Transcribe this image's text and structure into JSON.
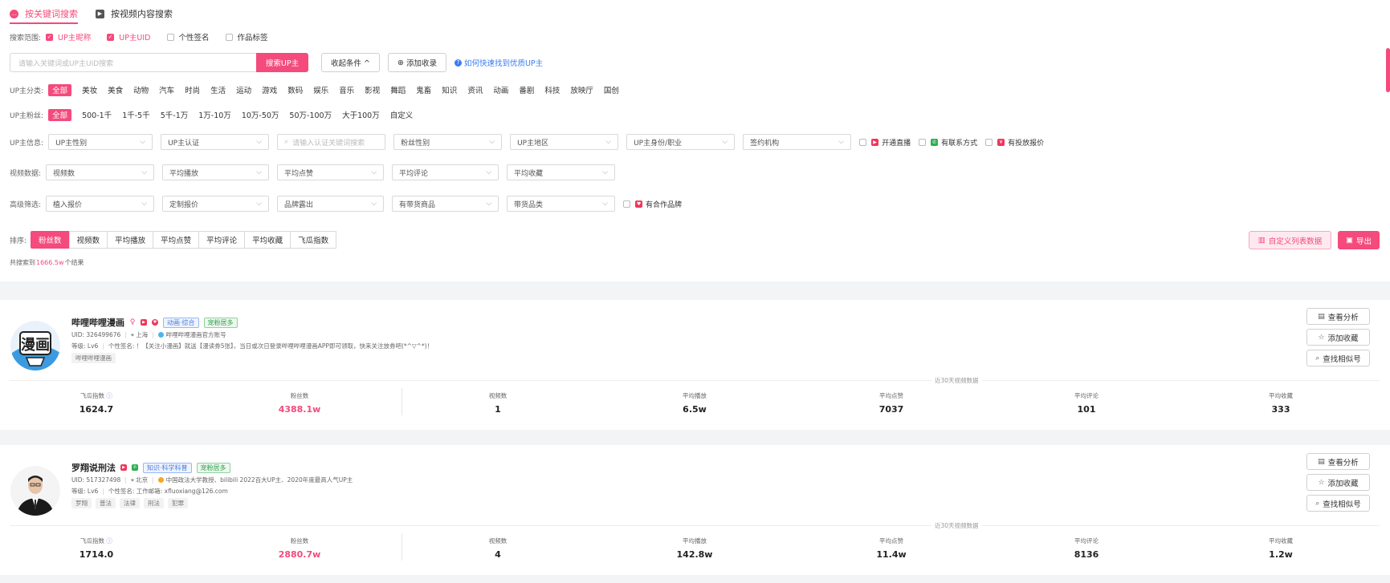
{
  "tabs": [
    {
      "label": "按关键词搜索"
    },
    {
      "label": "按视频内容搜索"
    }
  ],
  "scope": {
    "label": "搜索范围:",
    "options": [
      {
        "label": "UP主昵称",
        "checked": true
      },
      {
        "label": "UP主UID",
        "checked": true
      },
      {
        "label": "个性签名",
        "checked": false
      },
      {
        "label": "作品标签",
        "checked": false
      }
    ]
  },
  "search": {
    "placeholder": "请输入关键词或UP主UID搜索",
    "button": "搜索UP主",
    "collapse": "收起条件 ^",
    "add_fav": "添加收录",
    "help_link": "如何快速找到优质UP主"
  },
  "category": {
    "label": "UP主分类:",
    "items": [
      "全部",
      "美妆",
      "美食",
      "动物",
      "汽车",
      "时尚",
      "生活",
      "运动",
      "游戏",
      "数码",
      "娱乐",
      "音乐",
      "影视",
      "舞蹈",
      "鬼畜",
      "知识",
      "资讯",
      "动画",
      "番剧",
      "科技",
      "放映厅",
      "国创"
    ]
  },
  "fans": {
    "label": "UP主粉丝:",
    "items": [
      "全部",
      "500-1千",
      "1千-5千",
      "5千-1万",
      "1万-10万",
      "10万-50万",
      "50万-100万",
      "大于100万",
      "自定义"
    ]
  },
  "info": {
    "label": "UP主信息:",
    "selects": [
      "UP主性别",
      "UP主认证",
      "请输入认证关键词搜索",
      "粉丝性别",
      "UP主地区",
      "UP主身份/职业",
      "签约机构"
    ],
    "checks": [
      "开通直播",
      "有联系方式",
      "有投放报价"
    ]
  },
  "video": {
    "label": "视频数据:",
    "selects": [
      "视频数",
      "平均播放",
      "平均点赞",
      "平均评论",
      "平均收藏"
    ]
  },
  "advanced": {
    "label": "高级筛选:",
    "selects": [
      "植入报价",
      "定制报价",
      "品牌露出",
      "有带货商品",
      "带货品类"
    ],
    "check": "有合作品牌"
  },
  "sort": {
    "label": "排序:",
    "items": [
      "粉丝数",
      "视频数",
      "平均播放",
      "平均点赞",
      "平均评论",
      "平均收藏",
      "飞瓜指数"
    ],
    "custom_cols": "自定义列表数据",
    "export": "导出"
  },
  "result": {
    "prefix": "共搜索到 ",
    "count": "1666.5w",
    "suffix": "个结果"
  },
  "colors": {
    "accent": "#f44a7c",
    "blue": "#3a7cf2"
  },
  "cards": [
    {
      "name": "哔哩哔哩漫画",
      "tags": [
        "动画·综合",
        "宠粉居多"
      ],
      "uid": "UID: 326499676",
      "location": "上海",
      "verify": "哔哩哔哩漫画官方账号",
      "level": "等级: Lv6",
      "signature": "个性签名: ！【关注小漫画】就送【漫读券5张】，当日或次日登录哔哩哔哩漫画APP即可领取，快来关注放券吧(*^▽^*)！",
      "keywords": [
        "哔哩哔哩漫画"
      ],
      "actions": [
        "查看分析",
        "添加收藏",
        "查找相似号"
      ],
      "recent_label": "近30天视频数据",
      "stats": [
        {
          "label": "飞瓜指数",
          "value": "1624.7"
        },
        {
          "label": "粉丝数",
          "value": "4388.1w"
        },
        {
          "label": "视频数",
          "value": "1"
        },
        {
          "label": "平均播放",
          "value": "6.5w"
        },
        {
          "label": "平均点赞",
          "value": "7037"
        },
        {
          "label": "平均评论",
          "value": "101"
        },
        {
          "label": "平均收藏",
          "value": "333"
        }
      ],
      "avatar_text": "漫画"
    },
    {
      "name": "罗翔说刑法",
      "tags": [
        "知识·科学科普",
        "宠粉居多"
      ],
      "uid": "UID: 517327498",
      "location": "北京",
      "verify": "中国政法大学教授、bilibili 2022百大UP主、2020年度最高人气UP主",
      "level": "等级: Lv6",
      "signature": "个性签名: 工作邮箱: xfluoxiang@126.com",
      "keywords": [
        "罗翔",
        "普法",
        "法律",
        "刑法",
        "犯罪"
      ],
      "actions": [
        "查看分析",
        "添加收藏",
        "查找相似号"
      ],
      "recent_label": "近30天视频数据",
      "stats": [
        {
          "label": "飞瓜指数",
          "value": "1714.0"
        },
        {
          "label": "粉丝数",
          "value": "2880.7w"
        },
        {
          "label": "视频数",
          "value": "4"
        },
        {
          "label": "平均播放",
          "value": "142.8w"
        },
        {
          "label": "平均点赞",
          "value": "11.4w"
        },
        {
          "label": "平均评论",
          "value": "8136"
        },
        {
          "label": "平均收藏",
          "value": "1.2w"
        }
      ]
    }
  ]
}
